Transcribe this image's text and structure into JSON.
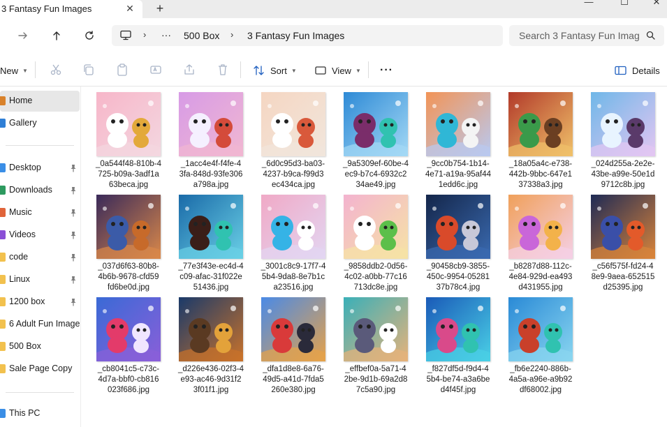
{
  "tab": {
    "title": "3 Fantasy Fun Images",
    "close_glyph": "✕",
    "new_glyph": "+"
  },
  "window": {
    "minimize": "—",
    "maximize": "☐",
    "close": "✕"
  },
  "address": {
    "path": [
      "500 Box",
      "3 Fantasy Fun Images"
    ],
    "overflow": "···",
    "search_placeholder": "Search 3 Fantasy Fun Imag"
  },
  "toolbar": {
    "new_label": "New",
    "sort_label": "Sort",
    "view_label": "View",
    "more_label": "···",
    "details_label": "Details"
  },
  "sidebar": {
    "items": [
      {
        "label": "Home",
        "icon": "home-icon",
        "color": "#d9822b",
        "selected": true,
        "pinned": false
      },
      {
        "label": "Gallery",
        "icon": "gallery-icon",
        "color": "#2f7fd6",
        "selected": false,
        "pinned": false
      },
      {
        "label": "Desktop",
        "icon": "desktop-icon",
        "color": "#3a8ee6",
        "selected": false,
        "pinned": true
      },
      {
        "label": "Downloads",
        "icon": "downloads-icon",
        "color": "#2d9a5f",
        "selected": false,
        "pinned": true
      },
      {
        "label": "Music",
        "icon": "music-icon",
        "color": "#e0643a",
        "selected": false,
        "pinned": true
      },
      {
        "label": "Videos",
        "icon": "videos-icon",
        "color": "#8a4fd6",
        "selected": false,
        "pinned": true
      },
      {
        "label": "code",
        "icon": "folder-icon",
        "color": "#f2c14e",
        "selected": false,
        "pinned": true
      },
      {
        "label": "Linux",
        "icon": "folder-icon",
        "color": "#f2c14e",
        "selected": false,
        "pinned": true
      },
      {
        "label": "1200 box",
        "icon": "folder-icon",
        "color": "#f2c14e",
        "selected": false,
        "pinned": true
      },
      {
        "label": "6 Adult Fun Images",
        "icon": "folder-icon",
        "color": "#f2c14e",
        "selected": false,
        "pinned": false
      },
      {
        "label": "500 Box",
        "icon": "folder-icon",
        "color": "#f2c14e",
        "selected": false,
        "pinned": false
      },
      {
        "label": "Sale Page Copy",
        "icon": "folder-icon",
        "color": "#f2c14e",
        "selected": false,
        "pinned": false
      },
      {
        "label": "This PC",
        "icon": "pc-icon",
        "color": "#3a8ee6",
        "selected": false,
        "pinned": false
      }
    ]
  },
  "files": [
    {
      "lines": [
        "_0a544f48-810b-4",
        "725-b09a-3adf1a",
        "63beca.jpg"
      ],
      "bg1": "#f7b6c9",
      "bg2": "#f3d7e0",
      "c1": "#ffffff",
      "c2": "#e3a93b"
    },
    {
      "lines": [
        "_1acc4e4f-f4fe-4",
        "3fa-848d-93fe306",
        "a798a.jpg"
      ],
      "bg1": "#d79be6",
      "bg2": "#f1b7d1",
      "c1": "#f5f0ff",
      "c2": "#d44b3a"
    },
    {
      "lines": [
        "_6d0c95d3-ba03-",
        "4237-b9ca-f99d3",
        "ec434ca.jpg"
      ],
      "bg1": "#f5d6c2",
      "bg2": "#f1e6dc",
      "c1": "#ffffff",
      "c2": "#d9593b"
    },
    {
      "lines": [
        "_9a5309ef-60be-4",
        "ec9-b7c4-6932c2",
        "34ae49.jpg"
      ],
      "bg1": "#2e8ad6",
      "bg2": "#a4d9f5",
      "c1": "#7a2d6a",
      "c2": "#30c2b0"
    },
    {
      "lines": [
        "_9cc0b754-1b14-",
        "4e71-a19a-95af44",
        "1edd6c.jpg"
      ],
      "bg1": "#f29457",
      "bg2": "#b9c9f0",
      "c1": "#2fb7d6",
      "c2": "#f4f4f4"
    },
    {
      "lines": [
        "_18a05a4c-e738-",
        "442b-9bbc-647e1",
        "37338a3.jpg"
      ],
      "bg1": "#b23a2a",
      "bg2": "#f0c16a",
      "c1": "#3a9a4a",
      "c2": "#6b3f22"
    },
    {
      "lines": [
        "_024d255a-2e2e-",
        "43be-a99e-50e1d",
        "9712c8b.jpg"
      ],
      "bg1": "#6fb7e8",
      "bg2": "#e3c6f2",
      "c1": "#e8f4ff",
      "c2": "#5a3a6a"
    },
    {
      "lines": [
        "_037d6f63-80b8-",
        "4b6b-9678-cfd59",
        "fd6be0d.jpg"
      ],
      "bg1": "#3a2a5a",
      "bg2": "#d9884a",
      "c1": "#3b5ba8",
      "c2": "#c76a2a"
    },
    {
      "lines": [
        "_77e3f43e-ec4d-4",
        "c09-afac-31f022e",
        "51436.jpg"
      ],
      "bg1": "#1a6aa8",
      "bg2": "#6ad0e6",
      "c1": "#3a1e18",
      "c2": "#30c2b0"
    },
    {
      "lines": [
        "_3001c8c9-17f7-4",
        "5b4-9da8-8e7b1c",
        "a23516.jpg"
      ],
      "bg1": "#f0a9c6",
      "bg2": "#e3d6f2",
      "c1": "#35b3e6",
      "c2": "#ffffff"
    },
    {
      "lines": [
        "_9858ddb2-0d56-",
        "4c02-a0bb-77c16",
        "713dc8e.jpg"
      ],
      "bg1": "#f3b3cf",
      "bg2": "#f6e3a5",
      "c1": "#ffffff",
      "c2": "#5cbf4a"
    },
    {
      "lines": [
        "_90458cb9-3855-",
        "450c-9954-05281",
        "37b78c4.jpg"
      ],
      "bg1": "#14264a",
      "bg2": "#3a6ab0",
      "c1": "#d94a2a",
      "c2": "#c8c8d8"
    },
    {
      "lines": [
        "_b8287d88-112c-",
        "4e84-929d-ea493",
        "d431955.jpg"
      ],
      "bg1": "#f0a05a",
      "bg2": "#f5d0e6",
      "c1": "#c966d9",
      "c2": "#f3b24a"
    },
    {
      "lines": [
        "_c56f575f-fd24-4",
        "8e9-9aea-652515",
        "d25395.jpg"
      ],
      "bg1": "#1e2a55",
      "bg2": "#d9843a",
      "c1": "#3a4fa8",
      "c2": "#e35a2a"
    },
    {
      "lines": [
        "_cb8041c5-c73c-",
        "4d7a-bbf0-cb816",
        "023f686.jpg"
      ],
      "bg1": "#3a6ad6",
      "bg2": "#8a5fd9",
      "c1": "#e33b6a",
      "c2": "#f0e6ff"
    },
    {
      "lines": [
        "_d226e436-02f3-4",
        "e93-ac46-9d31f2",
        "3f01f1.jpg"
      ],
      "bg1": "#1a3a6a",
      "bg2": "#c9722a",
      "c1": "#5a3a22",
      "c2": "#e3a23a"
    },
    {
      "lines": [
        "_dfa1d8e8-6a76-",
        "49d5-a41d-7fda5",
        "260e380.jpg"
      ],
      "bg1": "#4a8ae6",
      "bg2": "#e6a24a",
      "c1": "#d93a3a",
      "c2": "#2a2a3a"
    },
    {
      "lines": [
        "_effbef0a-5a71-4",
        "2be-9d1b-69a2d8",
        "7c5a90.jpg"
      ],
      "bg1": "#3ab0b8",
      "bg2": "#e6b27a",
      "c1": "#5a5a7a",
      "c2": "#ffffff"
    },
    {
      "lines": [
        "_f827df5d-f9d4-4",
        "5b4-be74-a3a6be",
        "d4f45f.jpg"
      ],
      "bg1": "#1a5ab8",
      "bg2": "#4ad0e6",
      "c1": "#d94a8a",
      "c2": "#30c2b0"
    },
    {
      "lines": [
        "_fb6e2240-886b-",
        "4a5a-a96e-a9b92",
        "df68002.jpg"
      ],
      "bg1": "#2a8ad6",
      "bg2": "#8ad6f0",
      "c1": "#c9402a",
      "c2": "#30c2b0"
    }
  ]
}
